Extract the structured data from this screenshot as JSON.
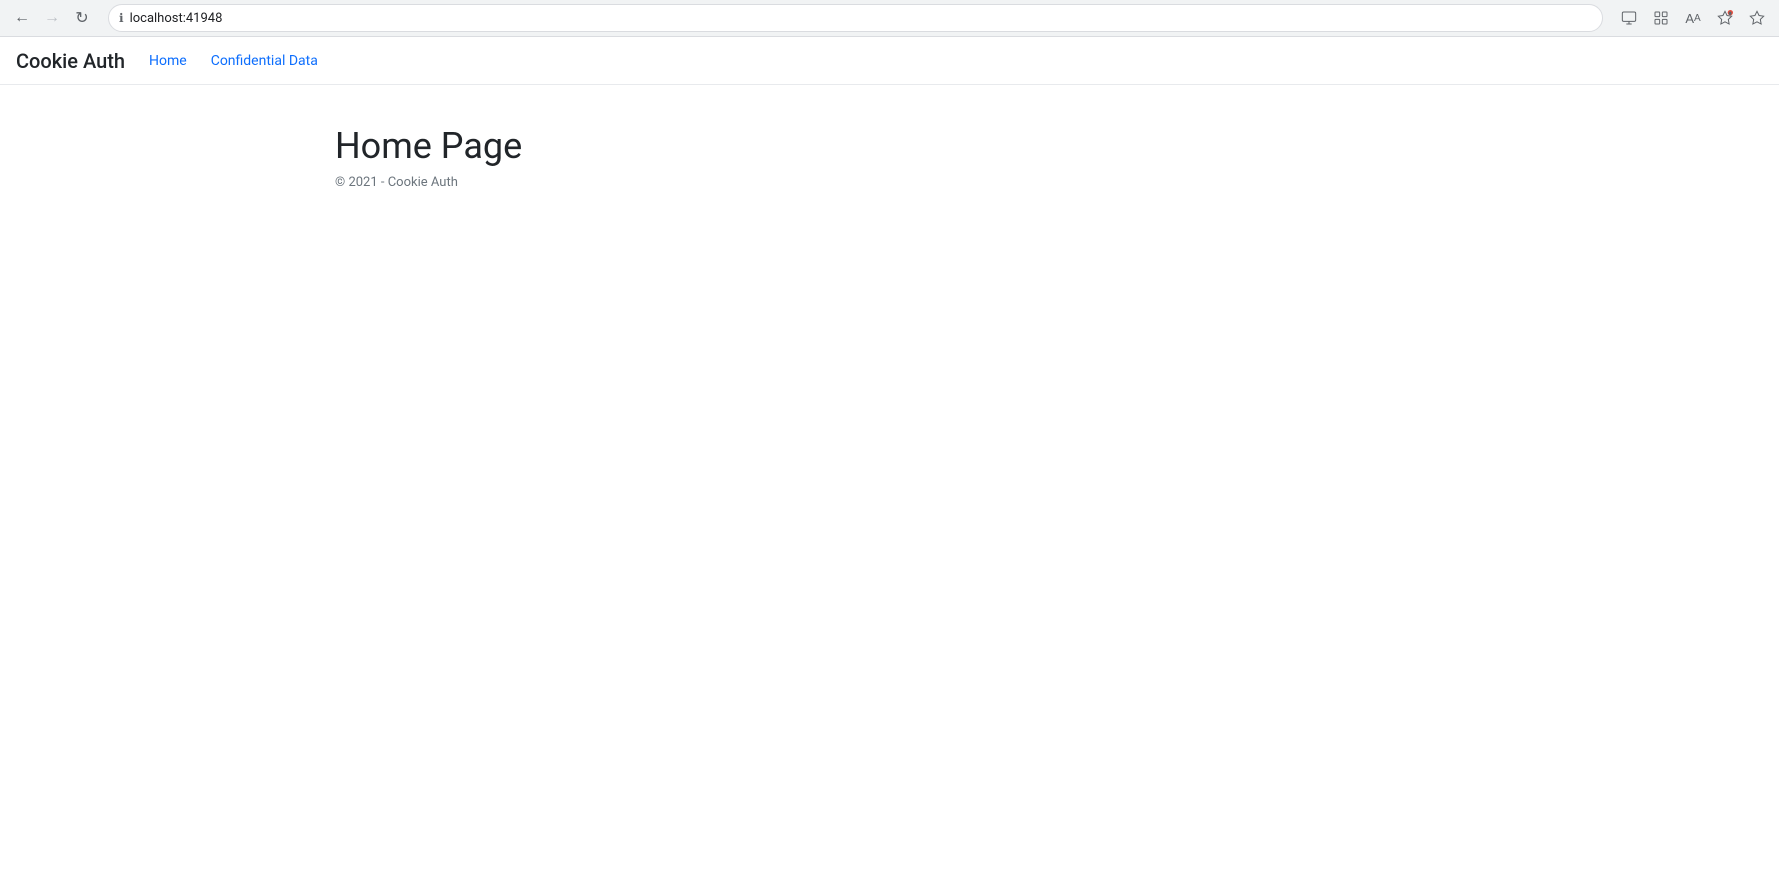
{
  "browser": {
    "url": "localhost:41948",
    "back_btn_label": "←",
    "forward_btn_label": "→",
    "reload_btn_label": "↻"
  },
  "nav": {
    "brand": "Cookie Auth",
    "links": [
      {
        "id": "home",
        "label": "Home"
      },
      {
        "id": "confidential",
        "label": "Confidential Data"
      }
    ]
  },
  "main": {
    "page_title": "Home Page",
    "copyright": "© 2021 - Cookie Auth"
  }
}
